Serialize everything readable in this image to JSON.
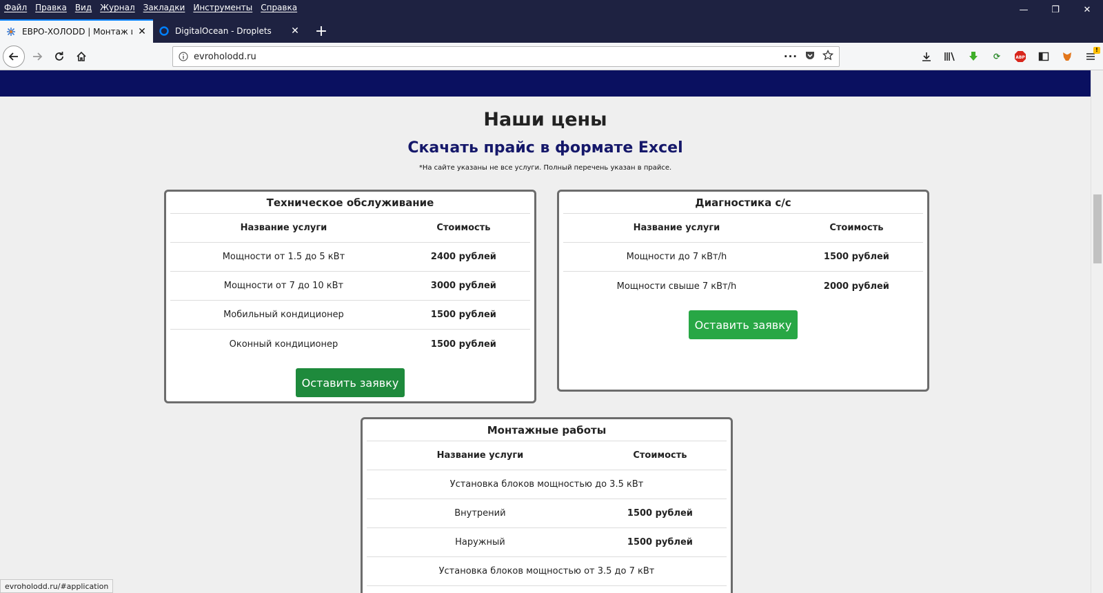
{
  "menu": [
    "Файл",
    "Правка",
    "Вид",
    "Журнал",
    "Закладки",
    "Инструменты",
    "Справка"
  ],
  "tabs": [
    {
      "title": "ЕВРО-ХОЛОDD | Монтаж и на",
      "active": true
    },
    {
      "title": "DigitalOcean - Droplets",
      "active": false
    }
  ],
  "address": {
    "url": "evroholodd.ru"
  },
  "page": {
    "title": "Наши цены",
    "excel_link": "Скачать прайс в формате Excel",
    "note": "*На сайте указаны не все услуги. Полный перечень указан в прайсе."
  },
  "cards": {
    "maintenance": {
      "title": "Техническое обслуживание",
      "head": [
        "Название услуги",
        "Стоимость"
      ],
      "rows": [
        [
          "Мощности от 1.5 до 5 кВт",
          "2400 рублей"
        ],
        [
          "Мощности от 7 до 10 кВт",
          "3000 рублей"
        ],
        [
          "Мобильный кондиционер",
          "1500 рублей"
        ],
        [
          "Оконный кондиционер",
          "1500 рублей"
        ]
      ],
      "button": "Оставить заявку"
    },
    "diagnostics": {
      "title": "Диагностика с/с",
      "head": [
        "Название услуги",
        "Стоимость"
      ],
      "rows": [
        [
          "Мощности до 7 кВт/h",
          "1500 рублей"
        ],
        [
          "Мощности свыше 7 кВт/h",
          "2000 рублей"
        ]
      ],
      "button": "Оставить заявку"
    },
    "installation": {
      "title": "Монтажные работы",
      "head": [
        "Название услуги",
        "Стоимость"
      ],
      "group1": "Установка блоков мощностью до 3.5 кВт",
      "rows": [
        [
          "Внутрений",
          "1500 рублей"
        ],
        [
          "Наружный",
          "1500 рублей"
        ]
      ],
      "group2": "Установка блоков мощностью от 3.5 до 7 кВт"
    }
  },
  "status_bar": "evroholodd.ru/#application",
  "colors": {
    "chrome": "#1e2241",
    "site_header": "#0a1060",
    "button_green_dark": "#1e8a3c",
    "button_green": "#28a745",
    "link": "#15186a"
  }
}
